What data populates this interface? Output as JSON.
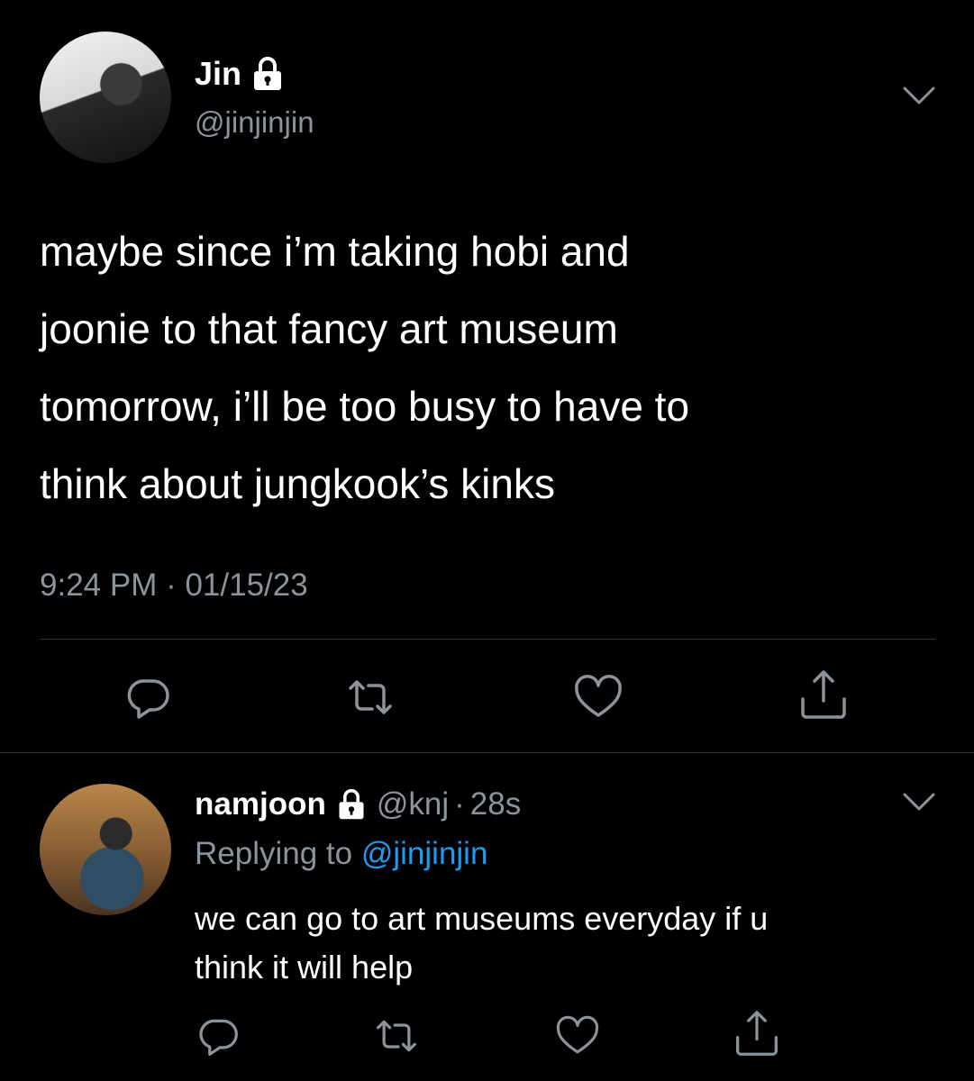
{
  "colors": {
    "background": "#000000",
    "text": "#ffffff",
    "secondary_text": "#8b949b",
    "link": "#1d9bf0",
    "divider": "#2f3336"
  },
  "main_tweet": {
    "author": {
      "name": "Jin",
      "handle": "@jinjinjin",
      "protected_icon": "lock-icon"
    },
    "text": "maybe since i’m taking hobi and joonie to that fancy art museum tomorrow, i’ll be too busy to have to think about jungkook’s kinks",
    "text_lines": [
      "maybe since i’m taking hobi and",
      "joonie to that fancy art museum",
      "tomorrow, i’ll be too busy to have to",
      "think about jungkook’s kinks"
    ],
    "meta": "9:24 PM · 01/15/23",
    "actions": [
      "reply-icon",
      "retweet-icon",
      "like-icon",
      "share-icon"
    ]
  },
  "reply_tweet": {
    "author": {
      "name": "namjoon",
      "handle": "@knj",
      "protected_icon": "lock-icon"
    },
    "separator": "·",
    "time": "28s",
    "replying_prefix": "Replying to",
    "replying_to": "@jinjinjin",
    "text_lines": [
      "we can go to art museums everyday if u",
      "think it will help"
    ],
    "actions": [
      "reply-icon",
      "retweet-icon",
      "like-icon",
      "share-icon"
    ]
  }
}
